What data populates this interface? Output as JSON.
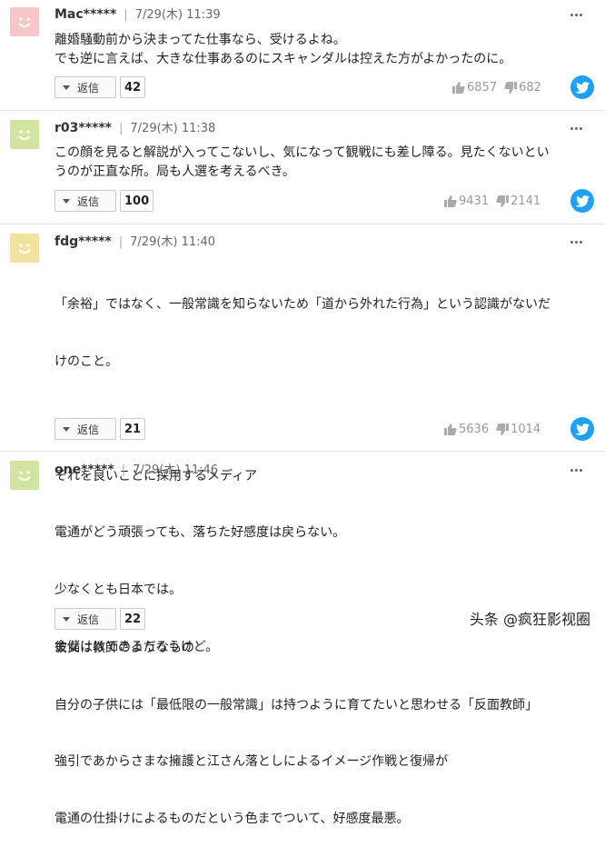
{
  "reply_label": "返信",
  "colors": {
    "twitter": "#1da1f2",
    "avatar_pink": "#f6c6c8",
    "avatar_green": "#d1e5a1",
    "avatar_yellow": "#f3e3a0"
  },
  "comments": [
    {
      "user": "Mac*****",
      "time": "7/29(木) 11:39",
      "lines": [
        "離婚騒動前から決まってた仕事なら、受けるよね。",
        "でも逆に言えば、大きな仕事あるのにスキャンダルは控えた方がよかったのに。"
      ],
      "reply_count": "42",
      "likes": "6857",
      "dislikes": "682",
      "avatar_color": "pink"
    },
    {
      "user": "r03*****",
      "time": "7/29(木) 11:38",
      "lines": [
        "この顔を見ると解説が入ってこないし、気になって観戦にも差し障る。見たくないとい",
        "うのが正直な所。局も人選を考えるべき。"
      ],
      "reply_count": "100",
      "likes": "9431",
      "dislikes": "2141",
      "avatar_color": "green"
    },
    {
      "user": "fdg*****",
      "time": "7/29(木) 11:40",
      "lines": [
        "「余裕」ではなく、一般常識を知らないため「道から外れた行為」という認識がないだ",
        "けのこと。",
        "",
        "それを良いことに採用するメディア",
        "",
        "",
        "彼女は教師のようなもの",
        "自分の子供には「最低限の一般常識」は持つように育てたいと思わせる「反面教師」"
      ],
      "reply_count": "21",
      "likes": "5636",
      "dislikes": "1014",
      "avatar_color": "yellow"
    },
    {
      "user": "one*****",
      "time": "7/29(木) 11:46",
      "lines": [
        "電通がどう頑張っても、落ちた好感度は戻らない。",
        "少なくとも日本では。",
        "金儲けはできるだろうけど。",
        "",
        "強引であからさまな擁護と江さん落としによるイメージ作戦と復帰が",
        "電通の仕掛けによるものだという色までついて、好感度最悪。"
      ],
      "reply_count": "22",
      "avatar_color": "green"
    }
  ],
  "watermark": "头条 @疯狂影视圈"
}
